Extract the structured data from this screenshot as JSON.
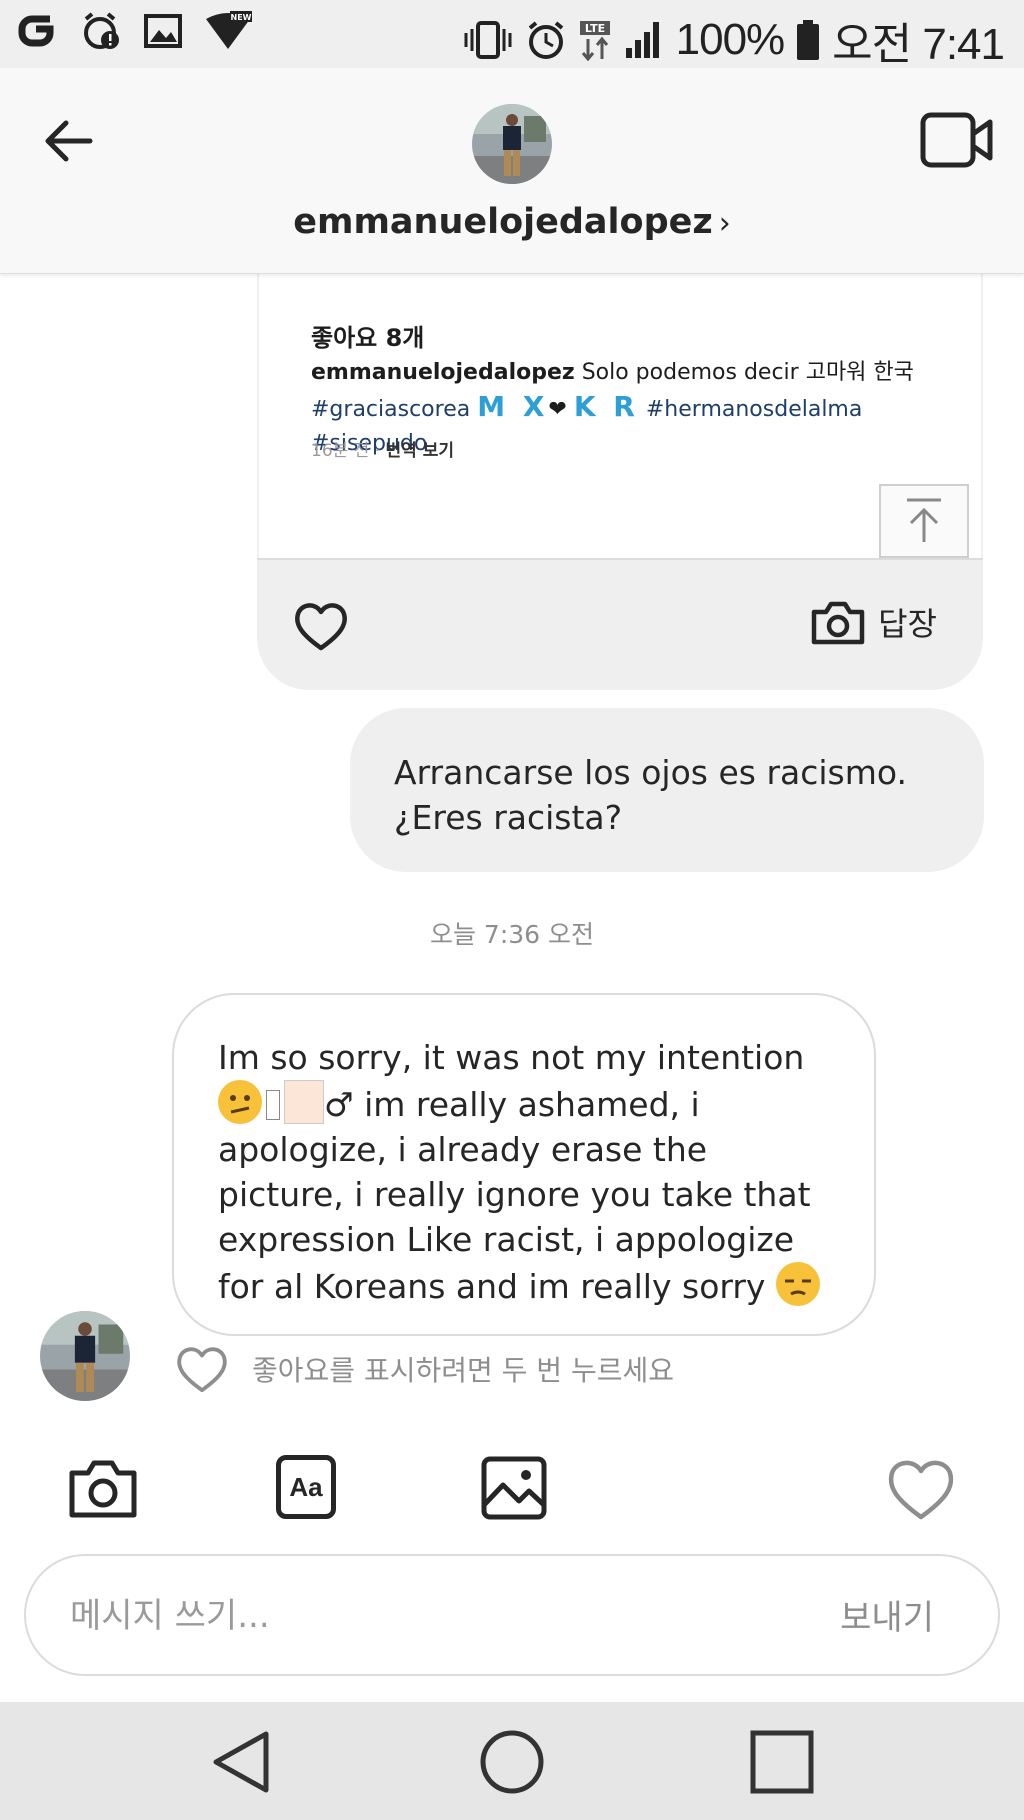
{
  "status_bar": {
    "battery": "100%",
    "time": "오전 7:41",
    "network": "LTE"
  },
  "header": {
    "username": "emmanuelojedalopez",
    "chevron": "›"
  },
  "shared_post": {
    "likes": "좋아요 8개",
    "caption_user": "emmanuelojedalopez",
    "caption_text": " Solo podemos decir 고마워 한국",
    "tag1": "#graciascorea",
    "flag_text": "M X",
    "heart_glyph": "❤",
    "flag_text2": "K R",
    "tag2": "#hermanosdelalma",
    "tag3": "#sisepudo",
    "time_ago": "16분 전",
    "dot": "·",
    "translate": "번역 보기",
    "reply_label": "답장"
  },
  "messages": {
    "outgoing_text": "Arrancarse los ojos es racismo. ¿Eres racista?",
    "timestamp": "오늘 7:36 오전",
    "incoming_line1": "Im so sorry, it was not my intention",
    "incoming_line2": " im really ashamed, i apologize, i already erase the picture,  i really ignore you take that expression Like racist, i appologize for al Koreans and im really sorry ",
    "incoming_symbol": "♂",
    "like_hint": "좋아요를 표시하려면 두 번 누르세요"
  },
  "toolbar": {
    "icons": [
      "camera-icon",
      "text-style-icon",
      "gallery-icon",
      "heart-icon"
    ],
    "text_style_label": "Aa"
  },
  "composer": {
    "placeholder": "메시지 쓰기...",
    "send_label": "보내기"
  },
  "colors": {
    "bubble_gray": "#efefef",
    "border": "#dbdbdb",
    "hint_gray": "#8e8e8e",
    "hashtag": "#1f3f6b",
    "flag_blue": "#2e9fd6",
    "emoji_yellow": "#f7c23a"
  }
}
